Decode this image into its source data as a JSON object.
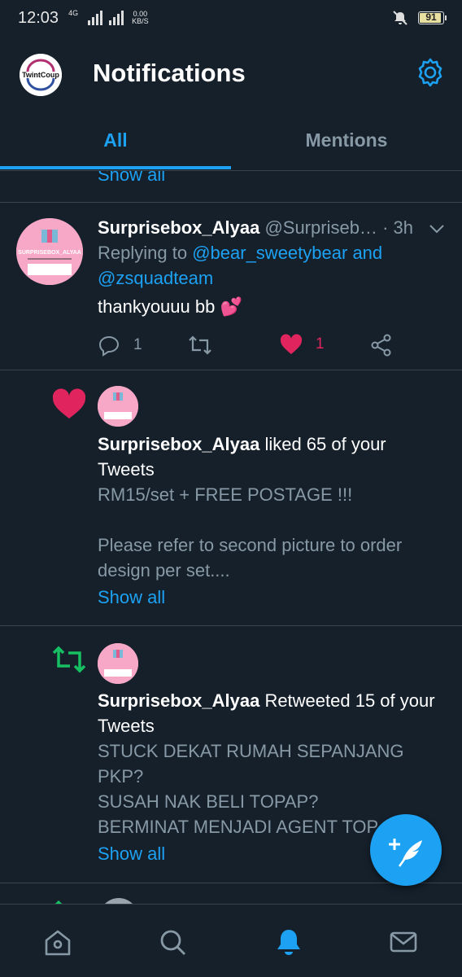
{
  "status": {
    "time": "12:03",
    "network": "4G",
    "speed_value": "0.00",
    "speed_unit": "KB/S",
    "battery": "91"
  },
  "header": {
    "title": "Notifications",
    "logo_text": "TwintCoup"
  },
  "tabs": [
    {
      "label": "All"
    },
    {
      "label": "Mentions"
    }
  ],
  "top_show_all": "Show all",
  "tweet": {
    "name": "Surprisebox_Alyaa",
    "handle": "@Surpriseb…",
    "time": "· 3h",
    "replying_prefix": "Replying to",
    "replying_1": "@bear_sweetybear",
    "replying_and": "and",
    "replying_2": "@zsquadteam",
    "text": "thankyouuu bb 💕",
    "reply_count": "1",
    "like_count": "1",
    "avatar_text": "SURPRISEBOX_ALYAA"
  },
  "like_notification": {
    "name": "Surprisebox_Alyaa",
    "action": "liked 65 of your",
    "action_2": "Tweets",
    "line1": "RM15/set + FREE POSTAGE !!!",
    "line2": "Please refer to second picture to order",
    "line3": "design per set....",
    "show_all": "Show all"
  },
  "retweet_notification": {
    "name": "Surprisebox_Alyaa",
    "action": "Retweeted 15 of your",
    "action_2": "Tweets",
    "line1": "STUCK DEKAT RUMAH SEPANJANG",
    "line2": "PKP?",
    "line3": "SUSAH NAK BELI TOPAP?",
    "line4": "BERMINAT MENJADI AGENT TOP",
    "show_all": "Show all"
  },
  "colors": {
    "background": "#15202b",
    "accent": "#1da1f2",
    "like": "#e0245e",
    "retweet": "#17bf63",
    "muted": "#8899a6"
  },
  "icons": [
    "home-icon",
    "search-icon",
    "bell-icon",
    "mail-icon",
    "gear-icon",
    "compose-icon"
  ]
}
